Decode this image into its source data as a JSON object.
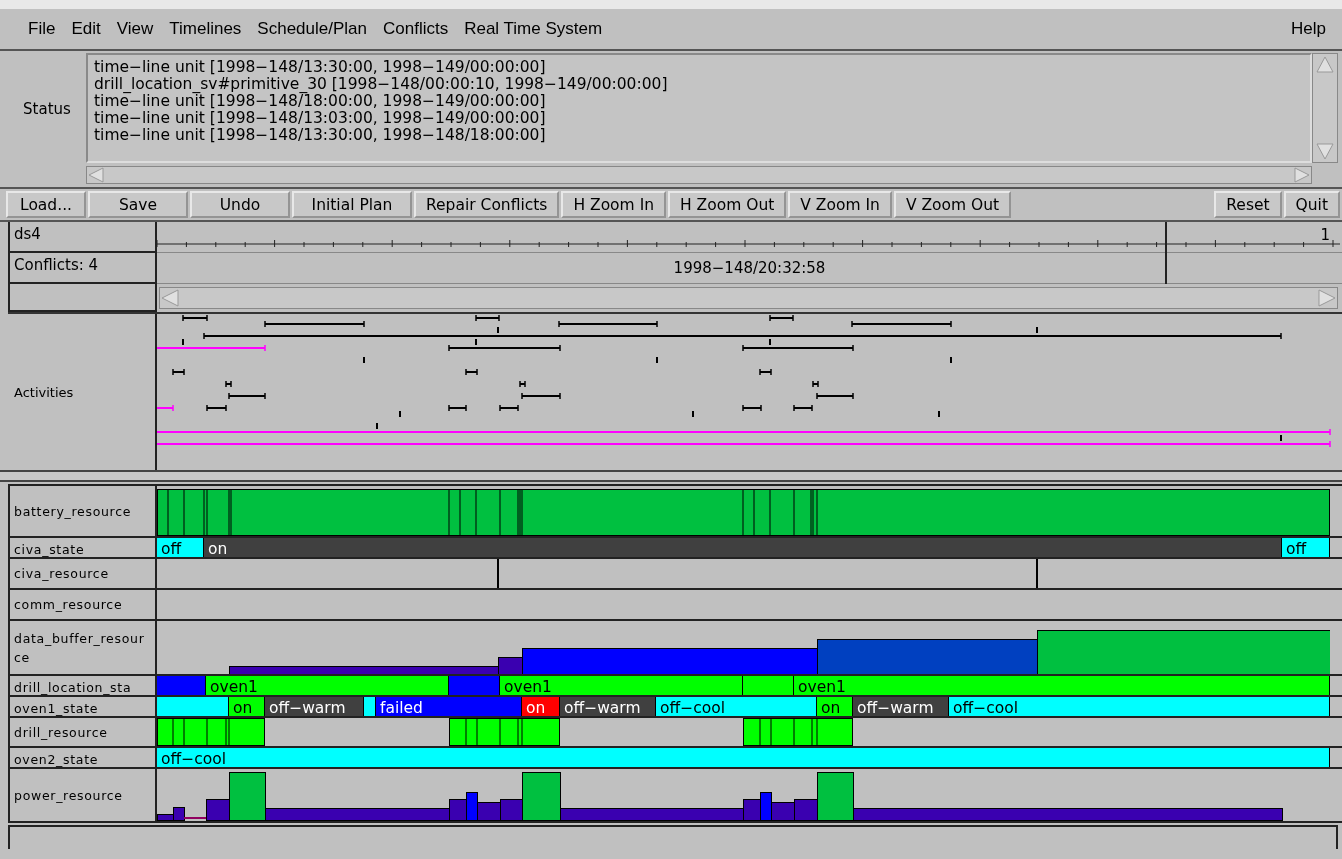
{
  "menu": {
    "items": [
      "File",
      "Edit",
      "View",
      "Timelines",
      "Schedule/Plan",
      "Conflicts",
      "Real Time System"
    ],
    "help": "Help"
  },
  "status": {
    "label": "Status",
    "lines": [
      "time−line unit [1998−148/13:30:00, 1998−149/00:00:00]",
      "drill_location_sv#primitive_30 [1998−148/00:00:10, 1998−149/00:00:00]",
      "time−line unit [1998−148/18:00:00, 1998−149/00:00:00]",
      "time−line unit [1998−148/13:03:00, 1998−149/00:00:00]",
      "time−line unit [1998−148/13:30:00, 1998−148/18:00:00]"
    ]
  },
  "toolbar": {
    "buttons": [
      "Load...",
      "Save",
      "Undo",
      "Initial Plan",
      "Repair Conflicts",
      "H Zoom In",
      "H Zoom Out",
      "V Zoom In",
      "V Zoom Out"
    ],
    "right_buttons": [
      "Reset",
      "Quit"
    ]
  },
  "header": {
    "plan": "ds4",
    "conflicts": "Conflicts: 4",
    "scale_label": "1",
    "cursor_time": "1998−148/20:32:58"
  },
  "activities": {
    "label": "Activities"
  },
  "timelines": [
    {
      "name": "battery_resource",
      "kind": "resource"
    },
    {
      "name": "civa_state",
      "kind": "state",
      "segments": [
        {
          "label": "off",
          "color": "#00ffff"
        },
        {
          "label": "on",
          "color": "#404040"
        },
        {
          "label": "off",
          "color": "#00ffff"
        }
      ]
    },
    {
      "name": "civa_resource",
      "kind": "resource"
    },
    {
      "name": "comm_resource",
      "kind": "resource"
    },
    {
      "name": "data_buffer_resource",
      "kind": "resource"
    },
    {
      "name": "drill_location_sta",
      "kind": "state",
      "segments": [
        {
          "color": "#0000ff"
        },
        {
          "label": "oven1",
          "color": "#00ff00"
        },
        {
          "color": "#0000ff"
        },
        {
          "label": "oven1",
          "color": "#00ff00"
        },
        {
          "color": "#00ff00"
        },
        {
          "label": "oven1",
          "color": "#00ff00"
        }
      ]
    },
    {
      "name": "oven1_state",
      "kind": "state",
      "segments": [
        {
          "color": "#00ffff"
        },
        {
          "label": "on",
          "color": "#00ff00"
        },
        {
          "label": "off−warm",
          "color": "#404040"
        },
        {
          "color": "#00ffff"
        },
        {
          "label": "failed",
          "color": "#0000ff"
        },
        {
          "label": "on",
          "color": "#ff0000"
        },
        {
          "label": "off−warm",
          "color": "#404040"
        },
        {
          "label": "off−cool",
          "color": "#00ffff"
        },
        {
          "label": "on",
          "color": "#00ff00"
        },
        {
          "label": "off−warm",
          "color": "#404040"
        },
        {
          "label": "off−cool",
          "color": "#00ffff"
        }
      ]
    },
    {
      "name": "drill_resource",
      "kind": "resource"
    },
    {
      "name": "oven2_state",
      "kind": "state",
      "segments": [
        {
          "label": "off−cool",
          "color": "#00ffff"
        }
      ]
    },
    {
      "name": "power_resource",
      "kind": "resource"
    }
  ]
}
